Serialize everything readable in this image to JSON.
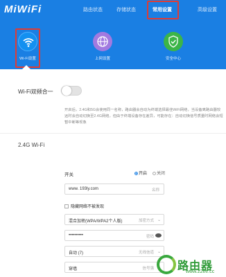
{
  "app": {
    "logo": "MiWiFi"
  },
  "topnav": {
    "items": [
      {
        "label": "路由状态",
        "active": false
      },
      {
        "label": "存储状态",
        "active": false
      },
      {
        "label": "常用设置",
        "active": true
      },
      {
        "label": "高级设置",
        "active": false
      }
    ]
  },
  "subnav": {
    "items": [
      {
        "label": "Wi-Fi设置",
        "icon": "wifi-icon",
        "color": "#1390f0",
        "active": true
      },
      {
        "label": "上网设置",
        "icon": "globe-icon",
        "color": "#a27ae0",
        "active": false
      },
      {
        "label": "安全中心",
        "icon": "shield-icon",
        "color": "#3cb548",
        "active": false
      }
    ]
  },
  "dual_band": {
    "label": "Wi-Fi双频合一",
    "enabled": false,
    "description": "开启后，2.4G和5G会使用同一名称，路由器会自动为终端选择最佳WiFi网络，当设备离路由器较远时会自动切换至2.4G网络，但由于终端设备存在差异，可能存在：自动切换信号质量时网络会短暂中断等现象"
  },
  "wifi24": {
    "section_title": "2.4G Wi-Fi",
    "switch_label": "开关",
    "radio_on": "开启",
    "radio_off": "关闭",
    "ssid": {
      "value": "www. 193ly.com",
      "tag": "名称"
    },
    "hide_ssid": {
      "label": "隐藏网络不被发现",
      "checked": false
    },
    "encryption": {
      "value": "混合加密(WPA/WPA2个人版)",
      "tag": "加密方式"
    },
    "password": {
      "value": "••••••••••",
      "tag": "密码"
    },
    "channel": {
      "value": "自动 (7)",
      "tag": "无线信道"
    },
    "signal": {
      "value": "穿墙",
      "tag": "信号强"
    }
  },
  "watermark": {
    "text": "路由器",
    "url": "www.22ee.cc"
  },
  "colors": {
    "accent": "#1a7fe3",
    "highlight": "#e23b32"
  }
}
